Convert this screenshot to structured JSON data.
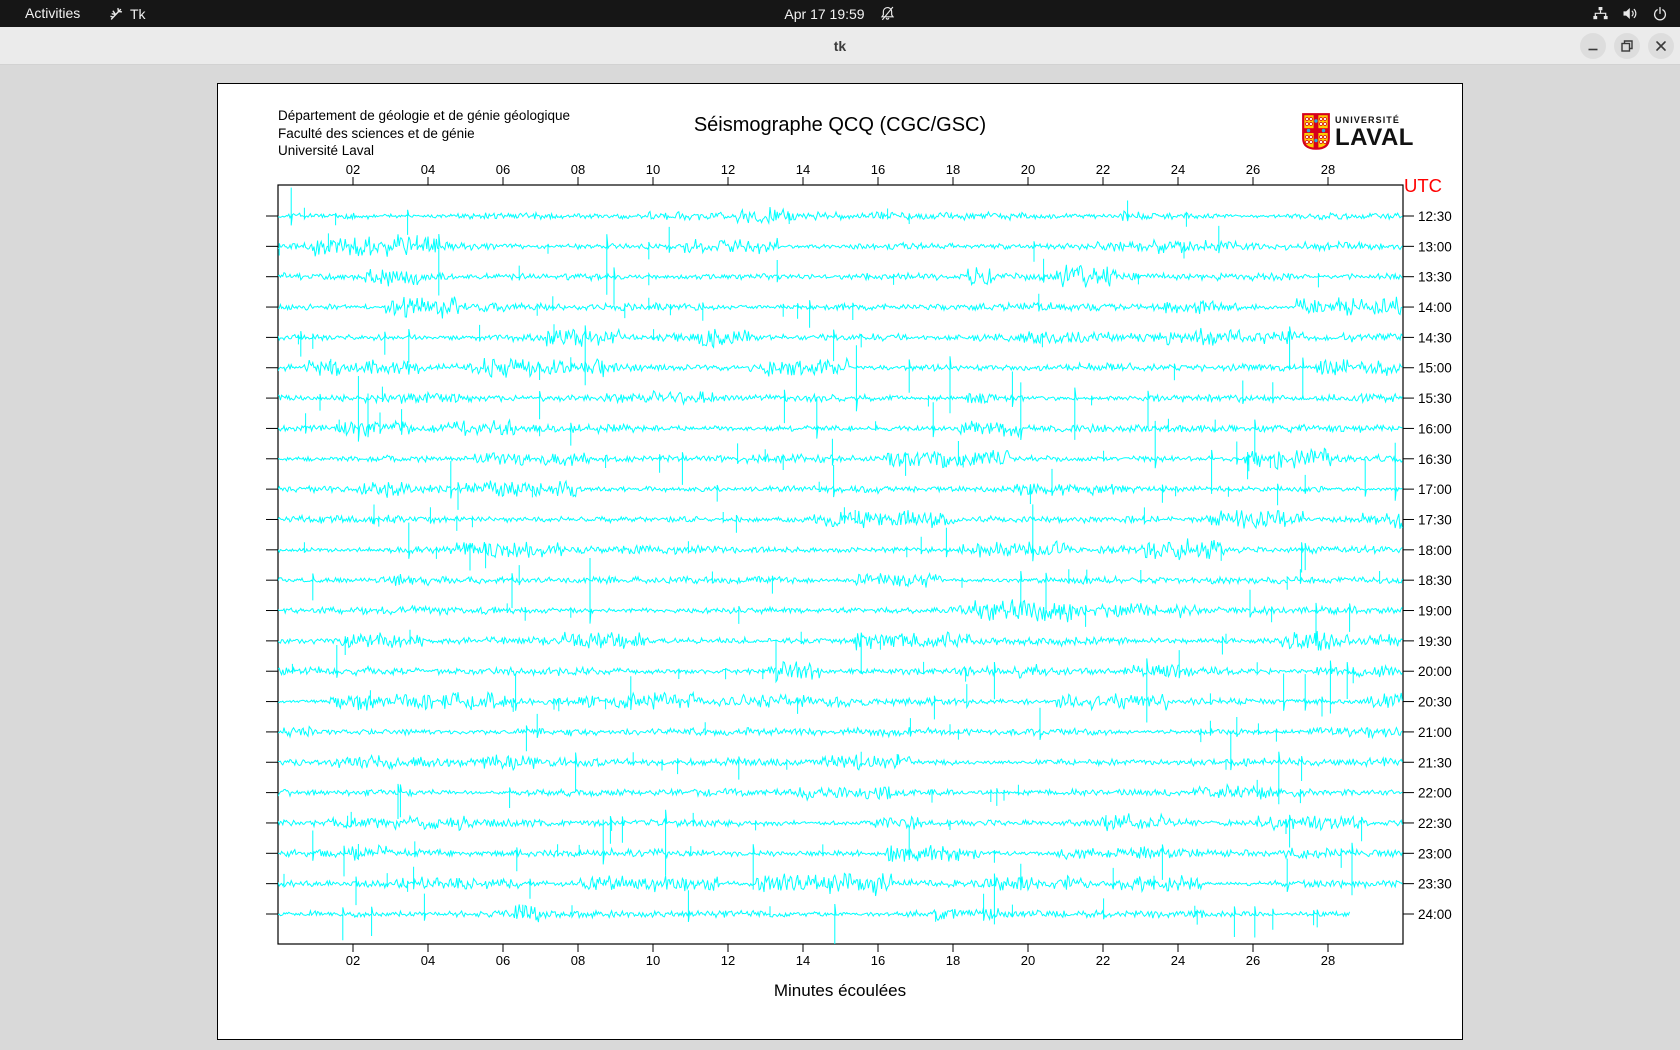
{
  "top_bar": {
    "activities_label": "Activities",
    "app_name": "Tk",
    "clock": "Apr 17  19:59",
    "notifications_muted": true,
    "status_icons": [
      "network-wired-icon",
      "volume-icon",
      "power-icon"
    ]
  },
  "window": {
    "title": "tk",
    "controls": [
      "minimize",
      "maximize",
      "close"
    ]
  },
  "panel": {
    "institution_lines": [
      "Département de géologie et de génie géologique",
      "Faculté des sciences et de génie",
      "Université Laval"
    ],
    "title": "Séismographe QCQ (CGC/GSC)",
    "logo": {
      "top": "UNIVERSITÉ",
      "bottom": "LAVAL"
    },
    "utc_label": "UTC",
    "xlabel": "Minutes écoulées"
  },
  "chart_data": {
    "type": "line",
    "title": "Séismographe QCQ (CGC/GSC)",
    "xlabel": "Minutes écoulées",
    "x_range_minutes": [
      0,
      30
    ],
    "x_tick_labels": [
      "02",
      "04",
      "06",
      "08",
      "10",
      "12",
      "14",
      "16",
      "18",
      "20",
      "22",
      "24",
      "26",
      "28"
    ],
    "y_axis_label": "UTC",
    "trace_labels_utc": [
      "12:30",
      "13:00",
      "13:30",
      "14:00",
      "14:30",
      "15:00",
      "15:30",
      "16:00",
      "16:30",
      "17:00",
      "17:30",
      "18:00",
      "18:30",
      "19:00",
      "19:30",
      "20:00",
      "20:30",
      "21:00",
      "21:30",
      "22:00",
      "22:30",
      "23:00",
      "23:30",
      "24:00"
    ],
    "traces_count": 24,
    "minutes_per_trace": 30,
    "last_trace_end_minute": 28.6,
    "trace_color": "#00ffff",
    "grid": false,
    "legend": "none",
    "seed": 7,
    "note": "helicorder drum record: continuous seismic background noise with random impulsive spikes; waveform synthesized to match visual texture"
  },
  "colors": {
    "top_bar_bg": "#161616",
    "titlebar_bg": "#ebebeb",
    "window_bg": "#d9d9d9",
    "panel_bg": "#ffffff",
    "frame": "#000000",
    "trace": "#00ffff",
    "utc_label": "#ff0000",
    "logo_red": "#d6001c",
    "logo_yellow": "#ffcd00",
    "logo_blue": "#2aa8e0"
  }
}
